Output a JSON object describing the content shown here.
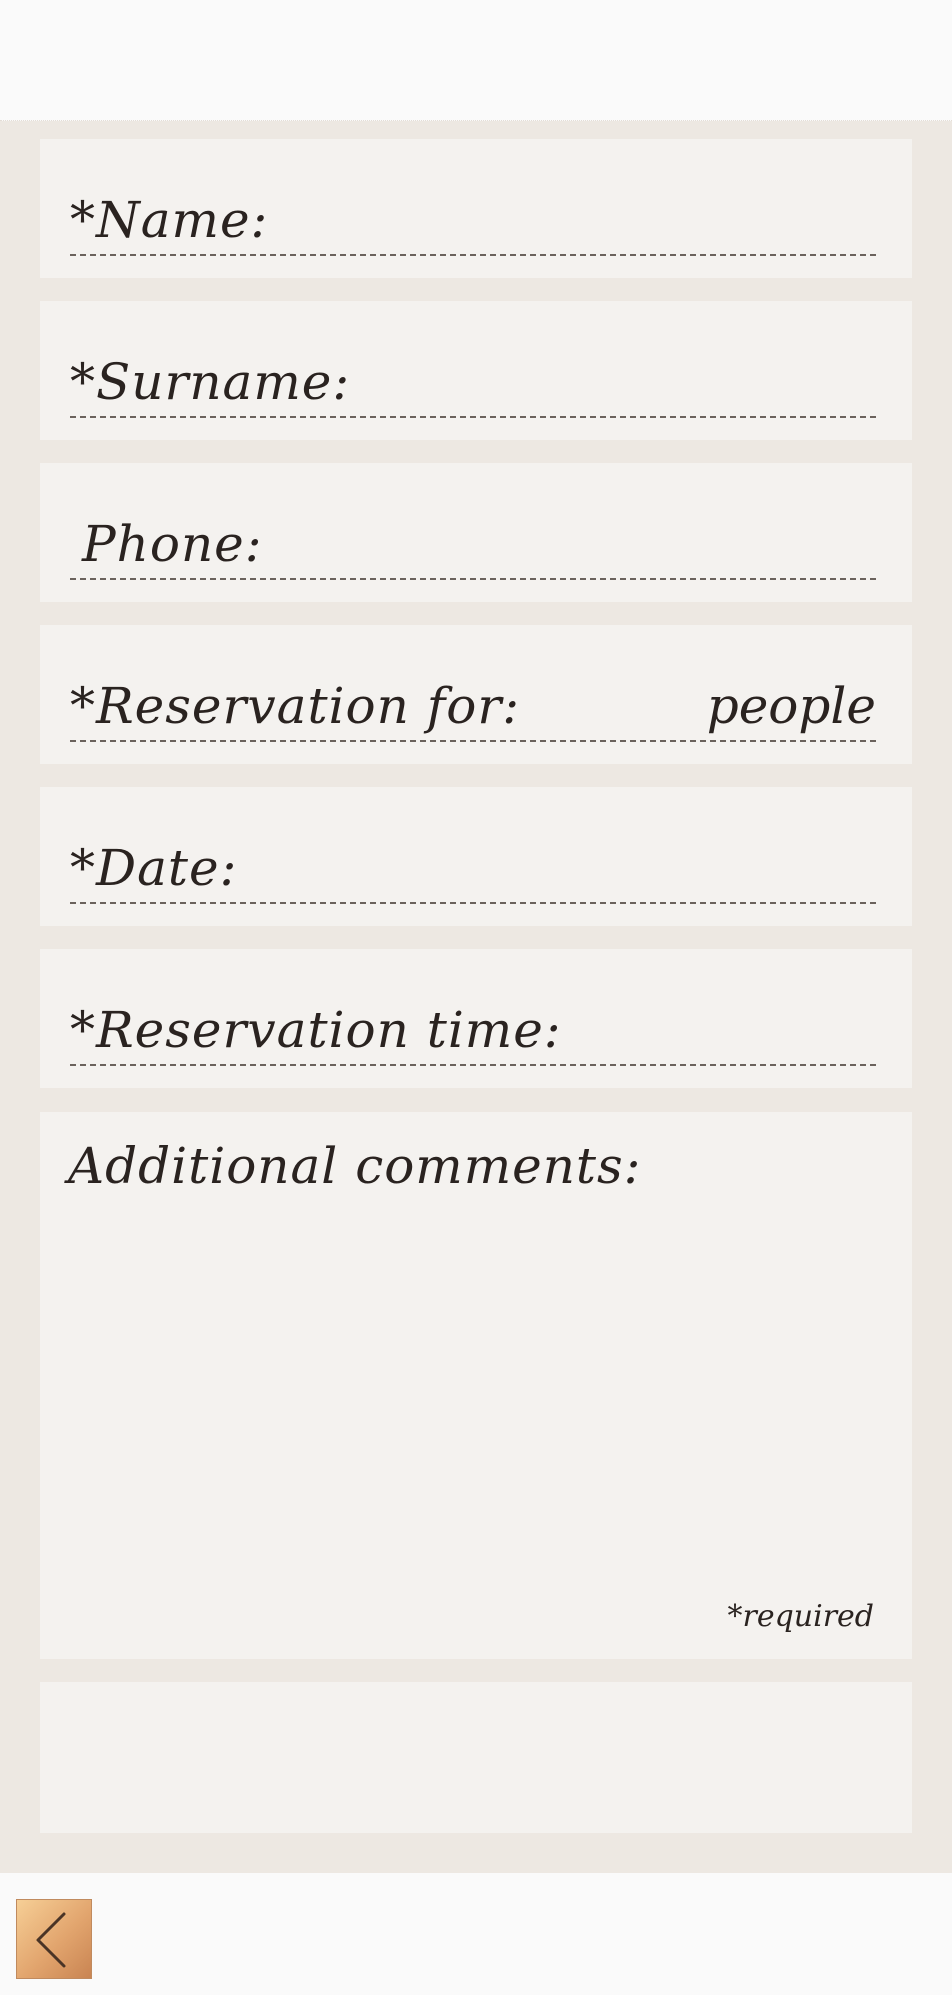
{
  "form": {
    "name_label": "*Name:",
    "surname_label": "*Surname:",
    "phone_label": "Phone:",
    "reservation_for_label": "*Reservation for:",
    "people_unit": "people",
    "date_label": "*Date:",
    "time_label": "*Reservation time:",
    "comments_label": "Additional comments:",
    "required_note": "*required"
  },
  "values": {
    "name": "",
    "surname": "",
    "phone": "",
    "people": "",
    "date": "",
    "time": "",
    "comments": ""
  },
  "nav": {
    "back_icon": "chevron-left-icon"
  }
}
